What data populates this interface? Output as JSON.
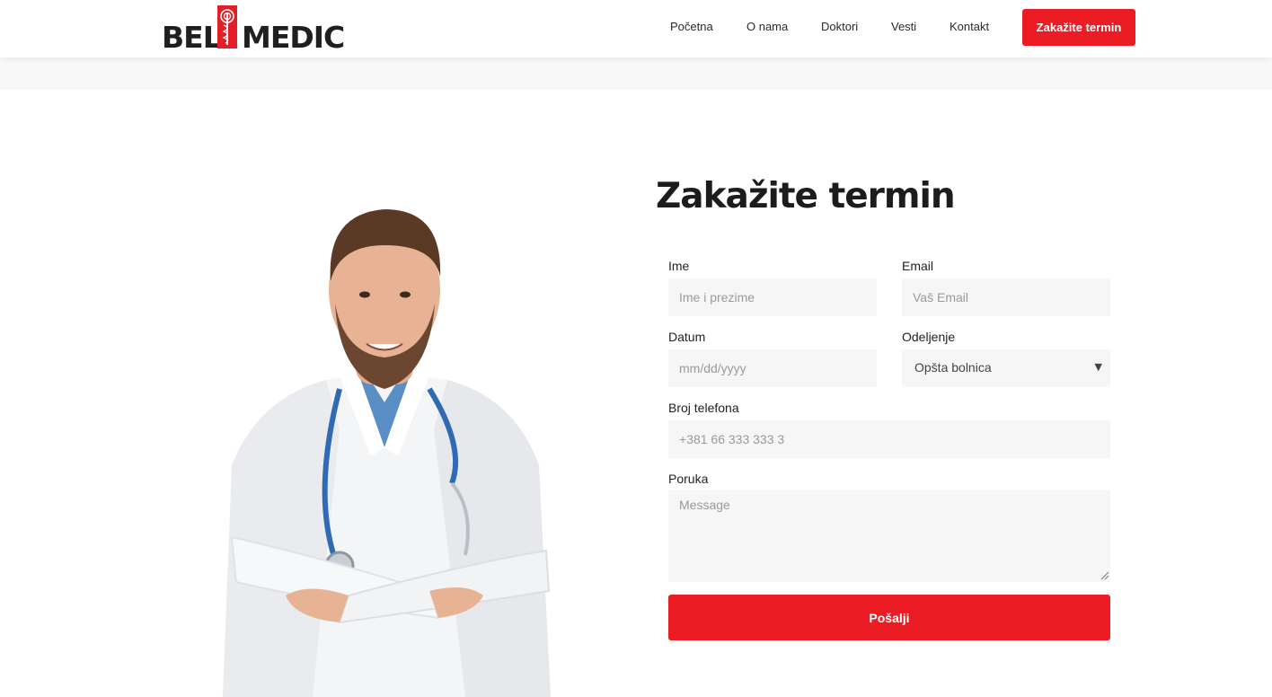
{
  "brand": {
    "logo_left": "BEL",
    "logo_right": "MEDIC",
    "accent_color": "#ec1c24"
  },
  "nav": {
    "items": [
      {
        "label": "Početna"
      },
      {
        "label": "O nama"
      },
      {
        "label": "Doktori"
      },
      {
        "label": "Vesti"
      },
      {
        "label": "Kontakt"
      }
    ],
    "cta_label": "Zakažite termin"
  },
  "form": {
    "title": "Zakažite termin",
    "name": {
      "label": "Ime",
      "placeholder": "Ime i prezime"
    },
    "email": {
      "label": "Email",
      "placeholder": "Vaš Email"
    },
    "date": {
      "label": "Datum",
      "placeholder": "mm/dd/yyyy"
    },
    "department": {
      "label": "Odeljenje",
      "selected": "Opšta bolnica",
      "arrow_icon": "caret-down-icon"
    },
    "phone": {
      "label": "Broj telefona",
      "placeholder": "+381 66 333 333 3"
    },
    "message": {
      "label": "Poruka",
      "placeholder": "Message"
    },
    "submit_label": "Pošalji"
  }
}
